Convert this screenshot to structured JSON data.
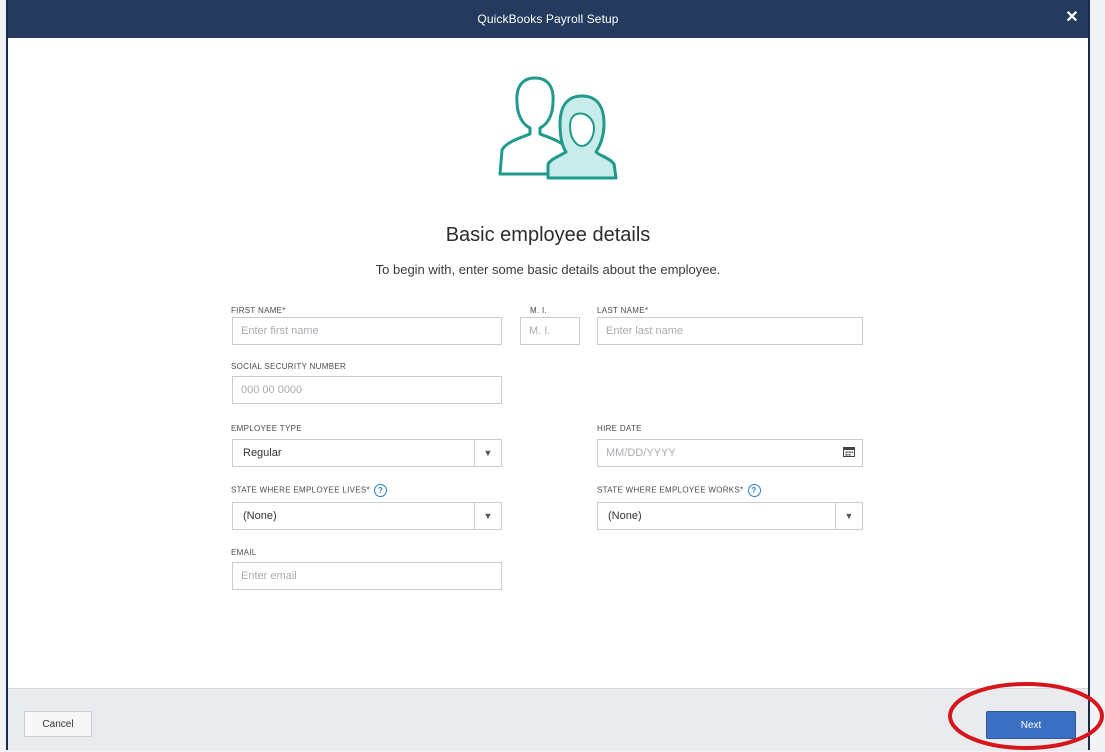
{
  "window": {
    "title": "QuickBooks Payroll Setup"
  },
  "header": {
    "heading": "Basic employee details",
    "subheading": "To begin with, enter some basic details about the employee."
  },
  "form": {
    "first_name": {
      "label": "FIRST NAME*",
      "placeholder": "Enter first name"
    },
    "mi": {
      "label": "M. I.",
      "placeholder": "M. I."
    },
    "last_name": {
      "label": "LAST NAME*",
      "placeholder": "Enter last name"
    },
    "ssn": {
      "label": "SOCIAL SECURITY NUMBER",
      "placeholder": "000 00 0000"
    },
    "employee_type": {
      "label": "EMPLOYEE TYPE",
      "value": "Regular"
    },
    "hire_date": {
      "label": "HIRE DATE",
      "placeholder": "MM/DD/YYYY"
    },
    "state_lives": {
      "label": "STATE WHERE EMPLOYEE LIVES*",
      "value": "(None)"
    },
    "state_works": {
      "label": "STATE WHERE EMPLOYEE WORKS*",
      "value": "(None)"
    },
    "email": {
      "label": "EMAIL",
      "placeholder": "Enter email"
    }
  },
  "footer": {
    "cancel_label": "Cancel",
    "next_label": "Next"
  },
  "colors": {
    "titlebar": "#243a5e",
    "accent_teal": "#1f9a8c",
    "primary_button": "#3a6fc4",
    "highlight_circle": "#d6161c"
  },
  "icons": {
    "close": "close-icon",
    "avatar": "employees-avatar-icon",
    "help": "help-icon",
    "chevron": "chevron-down-icon",
    "calendar": "calendar-icon"
  }
}
